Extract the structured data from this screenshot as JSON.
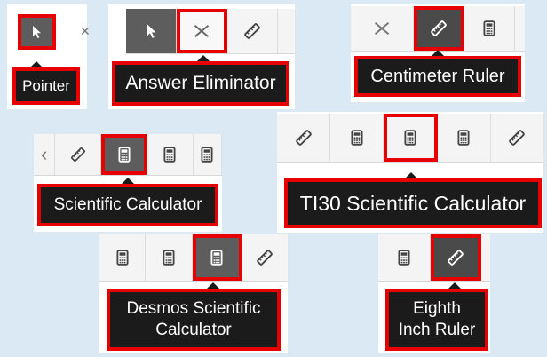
{
  "panels": {
    "pointer": {
      "tooltip": "Pointer"
    },
    "eliminator": {
      "tooltip": "Answer Eliminator",
      "partial": "›"
    },
    "centimeter": {
      "tooltip": "Centimeter Ruler"
    },
    "scientific": {
      "tooltip": "Scientific Calculator",
      "partial_left": "‹"
    },
    "ti30": {
      "tooltip": "TI30 Scientific Calculator"
    },
    "desmos": {
      "tooltip_line1": "Desmos Scientific",
      "tooltip_line2": "Calculator"
    },
    "eighth": {
      "tooltip_line1": "Eighth",
      "tooltip_line2": "Inch Ruler"
    }
  },
  "colors": {
    "highlight": "#e60000",
    "tooltip_bg": "#1b1b1b",
    "active_btn": "#5d5d5d",
    "toolbar_bg": "#f4f4f4"
  },
  "icons": [
    "pointer-icon",
    "close-icon",
    "ruler-icon",
    "calculator-icon"
  ]
}
